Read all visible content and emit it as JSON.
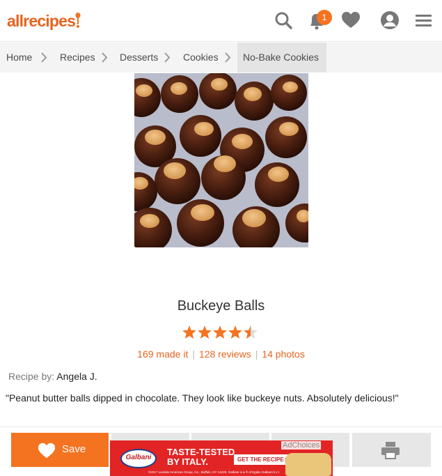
{
  "header": {
    "logo_text": "allrecipes",
    "notification_count": "1",
    "brand_color": "#f47321"
  },
  "breadcrumb": {
    "items": [
      {
        "label": "Home"
      },
      {
        "label": "Recipes"
      },
      {
        "label": "Desserts"
      },
      {
        "label": "Cookies"
      },
      {
        "label": "No-Bake Cookies"
      }
    ]
  },
  "recipe": {
    "title": "Buckeye Balls",
    "rating": 4.5,
    "rating_max": 5,
    "made_it": "169 made it",
    "reviews": "128 reviews",
    "photos": "14 photos",
    "recipe_by_label": "Recipe by:",
    "author": "Angela J.",
    "description": "\"Peanut butter balls dipped in chocolate. They look like buckeye nuts. Absolutely delicious!\""
  },
  "actions": {
    "save_label": "Save"
  },
  "ad": {
    "brand": "Galbani",
    "headline_1": "TASTE-TESTED",
    "headline_2": "BY ITALY.",
    "cta": "GET THE RECIPE ▶",
    "adchoices": "AdChoices",
    "fine_print": "©2017 Lactalis American Group, Inc., Buffalo, NY 14220. Galbani is a ® of Egidio Galbani S.r.l."
  },
  "icons": {
    "search": "search-icon",
    "bell": "bell-icon",
    "heart": "heart-icon",
    "user": "user-icon",
    "menu": "hamburger-menu-icon",
    "print": "print-icon"
  }
}
